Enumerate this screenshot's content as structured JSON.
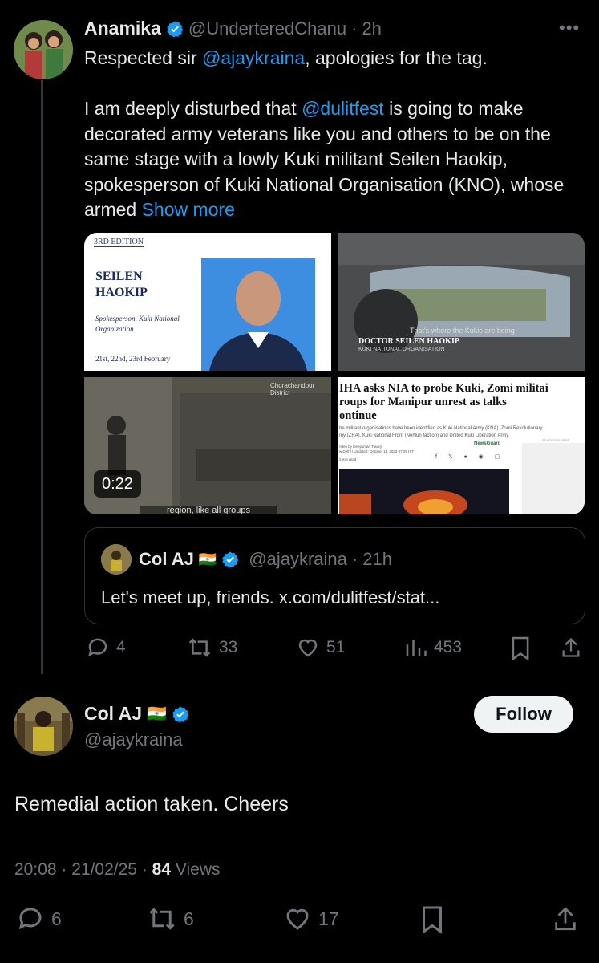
{
  "tweet1": {
    "name": "Anamika",
    "handle": "@UnderteredChanu",
    "time": "2h",
    "line1_pre": "Respected sir ",
    "line1_mention": "@ajaykraina",
    "line1_post": ", apologies for the tag.",
    "para_pre": "I am deeply disturbed that ",
    "para_mention": "@dulitfest",
    "para_text": " is going to make decorated army veterans like you and others to be on the same stage with a lowly Kuki militant Seilen Haokip, spokesperson of Kuki National Organisation (KNO), whose armed ",
    "show_more": "Show more",
    "media": {
      "card1_edition": "3RD EDITION",
      "card1_title1": "SEILEN",
      "card1_title2": "HAOKIP",
      "card1_sub1": "Spokesperson, Kuki National",
      "card1_sub2": "Organization",
      "card1_dates": "21st, 22nd, 23rd February",
      "card2_caption": "That's where the Kukis are being",
      "card2_name": "DOCTOR SEILEN HAOKIP",
      "card2_org": "KUKI NATIONAL ORGANISATION",
      "card3_location": "Churachandpur District",
      "card3_subtitle": "region, like all groups",
      "card3_duration": "0:22",
      "card4_headline1": "IHA asks NIA to probe Kuki, Zomi militai",
      "card4_headline2": "roups for Manipur unrest as talks",
      "card4_headline3": "ontinue",
      "card4_body1": "he militant organisations have been identified as Kuki National Army (KNA), Zomi Revolutionary",
      "card4_body2": "my (ZRA), Kuki National Front (Nehlun faction) and United Kuki Liberation Army.",
      "card4_author": "ritten by Deeptiman Tiwary",
      "card4_date": "w Delhi | Updated: October 11, 2023 07:29 IST",
      "card4_read": "2 min read",
      "card4_badge": "NewsGuard",
      "card4_ad": "ADVERTISEMENT"
    },
    "quote": {
      "name": "Col AJ",
      "flag": "🇮🇳",
      "handle": "@ajaykraina",
      "time": "21h",
      "text": "Let's meet up, friends. x.com/dulitfest/stat..."
    },
    "actions": {
      "replies": "4",
      "reposts": "33",
      "likes": "51",
      "views": "453"
    }
  },
  "tweet2": {
    "name": "Col AJ",
    "flag": "🇮🇳",
    "handle": "@ajaykraina",
    "follow_label": "Follow",
    "text": "Remedial action taken. Cheers",
    "time": "20:08",
    "date": "21/02/25",
    "views_count": "84",
    "views_label": "Views",
    "actions": {
      "replies": "6",
      "reposts": "6",
      "likes": "17"
    }
  },
  "colors": {
    "background": "#000000",
    "text": "#e7e9ea",
    "muted": "#71767b",
    "link": "#1d9bf0",
    "verified": "#1d9bf0"
  }
}
